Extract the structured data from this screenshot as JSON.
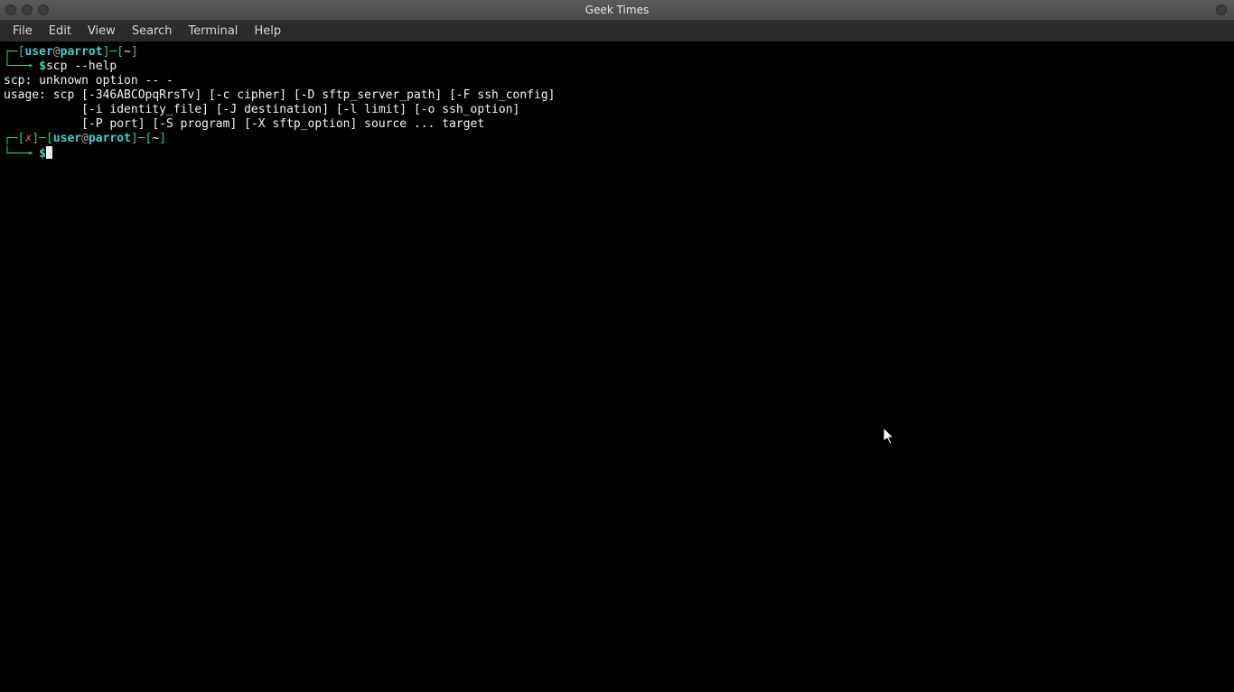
{
  "window": {
    "title": "Geek Times"
  },
  "menubar": {
    "items": [
      "File",
      "Edit",
      "View",
      "Search",
      "Terminal",
      "Help"
    ]
  },
  "prompt1": {
    "lbrace": "┌─[",
    "user": "user",
    "at": "@",
    "host": "parrot",
    "rbrace": "]─[",
    "cwd": "~",
    "rbrace2": "]",
    "arrow": "└──╼ ",
    "dollar": "$",
    "command": "scp --help"
  },
  "output": {
    "l1": "scp: unknown option -- -",
    "l2": "usage: scp [-346ABCOpqRrsTv] [-c cipher] [-D sftp_server_path] [-F ssh_config]",
    "l3": "           [-i identity_file] [-J destination] [-l limit] [-o ssh_option]",
    "l4": "           [-P port] [-S program] [-X sftp_option] source ... target"
  },
  "prompt2": {
    "lbrace": "┌─[",
    "err": "✗",
    "mid": "]─[",
    "user": "user",
    "at": "@",
    "host": "parrot",
    "rbrace": "]─[",
    "cwd": "~",
    "rbrace2": "]",
    "arrow": "└──╼ ",
    "dollar": "$"
  }
}
